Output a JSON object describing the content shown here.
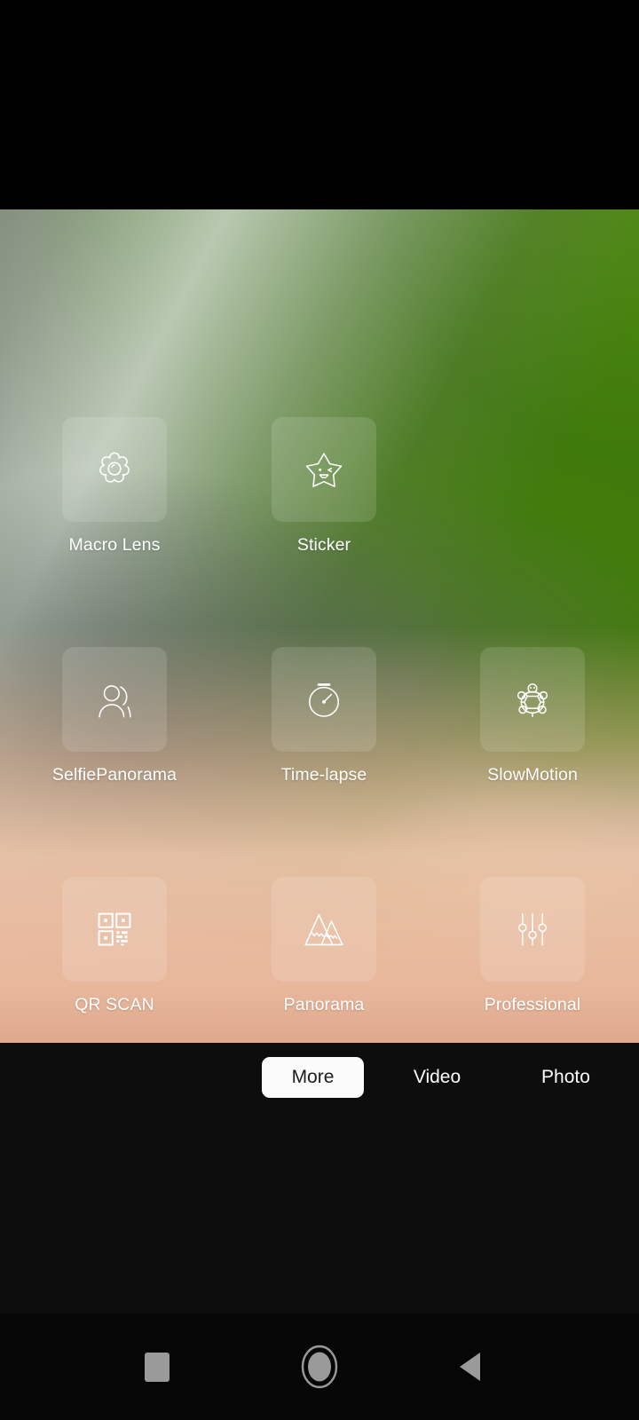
{
  "app": {
    "name": "Camera",
    "screen": "more-modes"
  },
  "theme": {
    "tile_fill": "rgba(255,255,255,0.13)",
    "label_color": "#ffffff",
    "selected_tab_bg": "#fbfbfb",
    "selected_tab_text": "#1c1c1c",
    "control_bg": "#0d0d0d",
    "nav_bg": "#060606",
    "nav_icon_color": "#9a9a9a",
    "status_bar_bg": "#000000"
  },
  "viewfinder": {
    "description": "blurred live camera preview",
    "colors": {
      "foliage_green": "#46820f",
      "grey_band": "#cdd6cc",
      "mid_dark": "#5c6660",
      "peach": "#e8b79b",
      "deep_peach": "#cd9378",
      "teal_patch": "#7a8c88"
    }
  },
  "modes": {
    "rows": [
      [
        {
          "label": "Macro Lens",
          "icon": "flower-icon"
        },
        {
          "label": "Sticker",
          "icon": "star-face-icon"
        }
      ],
      [
        {
          "label": "SelfiePanorama",
          "icon": "person-panorama-icon"
        },
        {
          "label": "Time-lapse",
          "icon": "stopwatch-icon"
        },
        {
          "label": "SlowMotion",
          "icon": "turtle-icon"
        }
      ],
      [
        {
          "label": "QR SCAN",
          "icon": "qr-code-icon"
        },
        {
          "label": "Panorama",
          "icon": "mountains-icon"
        },
        {
          "label": "Professional",
          "icon": "sliders-icon"
        }
      ]
    ]
  },
  "mode_tabs": {
    "items": [
      {
        "label": "More",
        "selected": true
      },
      {
        "label": "Video",
        "selected": false
      },
      {
        "label": "Photo",
        "selected": false
      }
    ]
  },
  "nav_bar": {
    "buttons": [
      {
        "name": "recents",
        "icon": "square-icon"
      },
      {
        "name": "home",
        "icon": "circle-icon"
      },
      {
        "name": "back",
        "icon": "triangle-left-icon"
      }
    ]
  }
}
